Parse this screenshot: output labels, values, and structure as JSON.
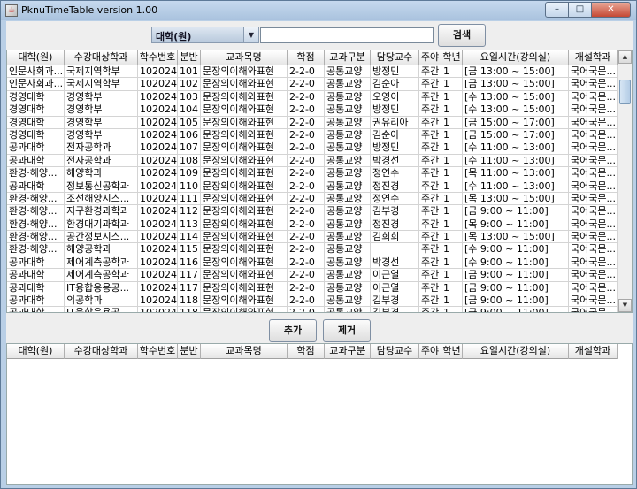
{
  "window": {
    "title": "PknuTimeTable version 1.00",
    "controls": {
      "minimize": "–",
      "maximize": "□",
      "close": "✕"
    }
  },
  "search": {
    "category_value": "대학(원)",
    "query_value": "",
    "search_label": "검색"
  },
  "actions": {
    "add_label": "추가",
    "remove_label": "제거"
  },
  "columns": [
    "대학(원)",
    "수강대상학과",
    "학수번호",
    "분반",
    "교과목명",
    "학점",
    "교과구분",
    "담당교수",
    "주야",
    "학년",
    "요일시간(강의실)",
    "개설학과"
  ],
  "rows": [
    [
      "인문사회과...",
      "국제지역학부",
      "102024",
      "101",
      "문장의이해와표현",
      "2-2-0",
      "공통교양",
      "방정민",
      "주간",
      "1",
      "[금 13:00 ~ 15:00]",
      "국어국문..."
    ],
    [
      "인문사회과...",
      "국제지역학부",
      "102024",
      "102",
      "문장의이해와표현",
      "2-2-0",
      "공통교양",
      "김순아",
      "주간",
      "1",
      "[금 13:00 ~ 15:00]",
      "국어국문..."
    ],
    [
      "경영대학",
      "경영학부",
      "102024",
      "103",
      "문장의이해와표현",
      "2-2-0",
      "공통교양",
      "오영이",
      "주간",
      "1",
      "[수 13:00 ~ 15:00]",
      "국어국문..."
    ],
    [
      "경영대학",
      "경영학부",
      "102024",
      "104",
      "문장의이해와표현",
      "2-2-0",
      "공통교양",
      "방정민",
      "주간",
      "1",
      "[수 13:00 ~ 15:00]",
      "국어국문..."
    ],
    [
      "경영대학",
      "경영학부",
      "102024",
      "105",
      "문장의이해와표현",
      "2-2-0",
      "공통교양",
      "권유리아",
      "주간",
      "1",
      "[금 15:00 ~ 17:00]",
      "국어국문..."
    ],
    [
      "경영대학",
      "경영학부",
      "102024",
      "106",
      "문장의이해와표현",
      "2-2-0",
      "공통교양",
      "김순아",
      "주간",
      "1",
      "[금 15:00 ~ 17:00]",
      "국어국문..."
    ],
    [
      "공과대학",
      "전자공학과",
      "102024",
      "107",
      "문장의이해와표현",
      "2-2-0",
      "공통교양",
      "방정민",
      "주간",
      "1",
      "[수 11:00 ~ 13:00]",
      "국어국문..."
    ],
    [
      "공과대학",
      "전자공학과",
      "102024",
      "108",
      "문장의이해와표현",
      "2-2-0",
      "공통교양",
      "박경선",
      "주간",
      "1",
      "[수 11:00 ~ 13:00]",
      "국어국문..."
    ],
    [
      "환경·해양...",
      "해양학과",
      "102024",
      "109",
      "문장의이해와표현",
      "2-2-0",
      "공통교양",
      "정연수",
      "주간",
      "1",
      "[목 11:00 ~ 13:00]",
      "국어국문..."
    ],
    [
      "공과대학",
      "정보통신공학과",
      "102024",
      "110",
      "문장의이해와표현",
      "2-2-0",
      "공통교양",
      "정진경",
      "주간",
      "1",
      "[수 11:00 ~ 13:00]",
      "국어국문..."
    ],
    [
      "환경·해양...",
      "조선해양시스...",
      "102024",
      "111",
      "문장의이해와표현",
      "2-2-0",
      "공통교양",
      "정연수",
      "주간",
      "1",
      "[목 13:00 ~ 15:00]",
      "국어국문..."
    ],
    [
      "환경·해양...",
      "지구환경과학과",
      "102024",
      "112",
      "문장의이해와표현",
      "2-2-0",
      "공통교양",
      "김부경",
      "주간",
      "1",
      "[금 9:00 ~ 11:00]",
      "국어국문..."
    ],
    [
      "환경·해양...",
      "환경대기과학과",
      "102024",
      "113",
      "문장의이해와표현",
      "2-2-0",
      "공통교양",
      "정진경",
      "주간",
      "1",
      "[목 9:00 ~ 11:00]",
      "국어국문..."
    ],
    [
      "환경·해양...",
      "공간정보시스...",
      "102024",
      "114",
      "문장의이해와표현",
      "2-2-0",
      "공통교양",
      "김희희",
      "주간",
      "1",
      "[목 13:00 ~ 15:00]",
      "국어국문..."
    ],
    [
      "환경·해양...",
      "해양공학과",
      "102024",
      "115",
      "문장의이해와표현",
      "2-2-0",
      "공통교양",
      "",
      "주간",
      "1",
      "[수 9:00 ~ 11:00]",
      "국어국문..."
    ],
    [
      "공과대학",
      "제어계측공학과",
      "102024",
      "116",
      "문장의이해와표현",
      "2-2-0",
      "공통교양",
      "박경선",
      "주간",
      "1",
      "[수 9:00 ~ 11:00]",
      "국어국문..."
    ],
    [
      "공과대학",
      "제어계측공학과",
      "102024",
      "117",
      "문장의이해와표현",
      "2-2-0",
      "공통교양",
      "이근열",
      "주간",
      "1",
      "[금 9:00 ~ 11:00]",
      "국어국문..."
    ],
    [
      "공과대학",
      "IT융합응용공...",
      "102024",
      "117",
      "문장의이해와표현",
      "2-2-0",
      "공통교양",
      "이근열",
      "주간",
      "1",
      "[금 9:00 ~ 11:00]",
      "국어국문..."
    ],
    [
      "공과대학",
      "의공학과",
      "102024",
      "118",
      "문장의이해와표현",
      "2-2-0",
      "공통교양",
      "김부경",
      "주간",
      "1",
      "[금 9:00 ~ 11:00]",
      "국어국문..."
    ],
    [
      "공과대학",
      "IT융합응용공...",
      "102024",
      "118",
      "문장의이해와표현",
      "2-2-0",
      "공통교양",
      "김부경",
      "주간",
      "1",
      "[금 9:00 ~ 11:00]",
      "국어국문..."
    ]
  ],
  "selected_rows": []
}
